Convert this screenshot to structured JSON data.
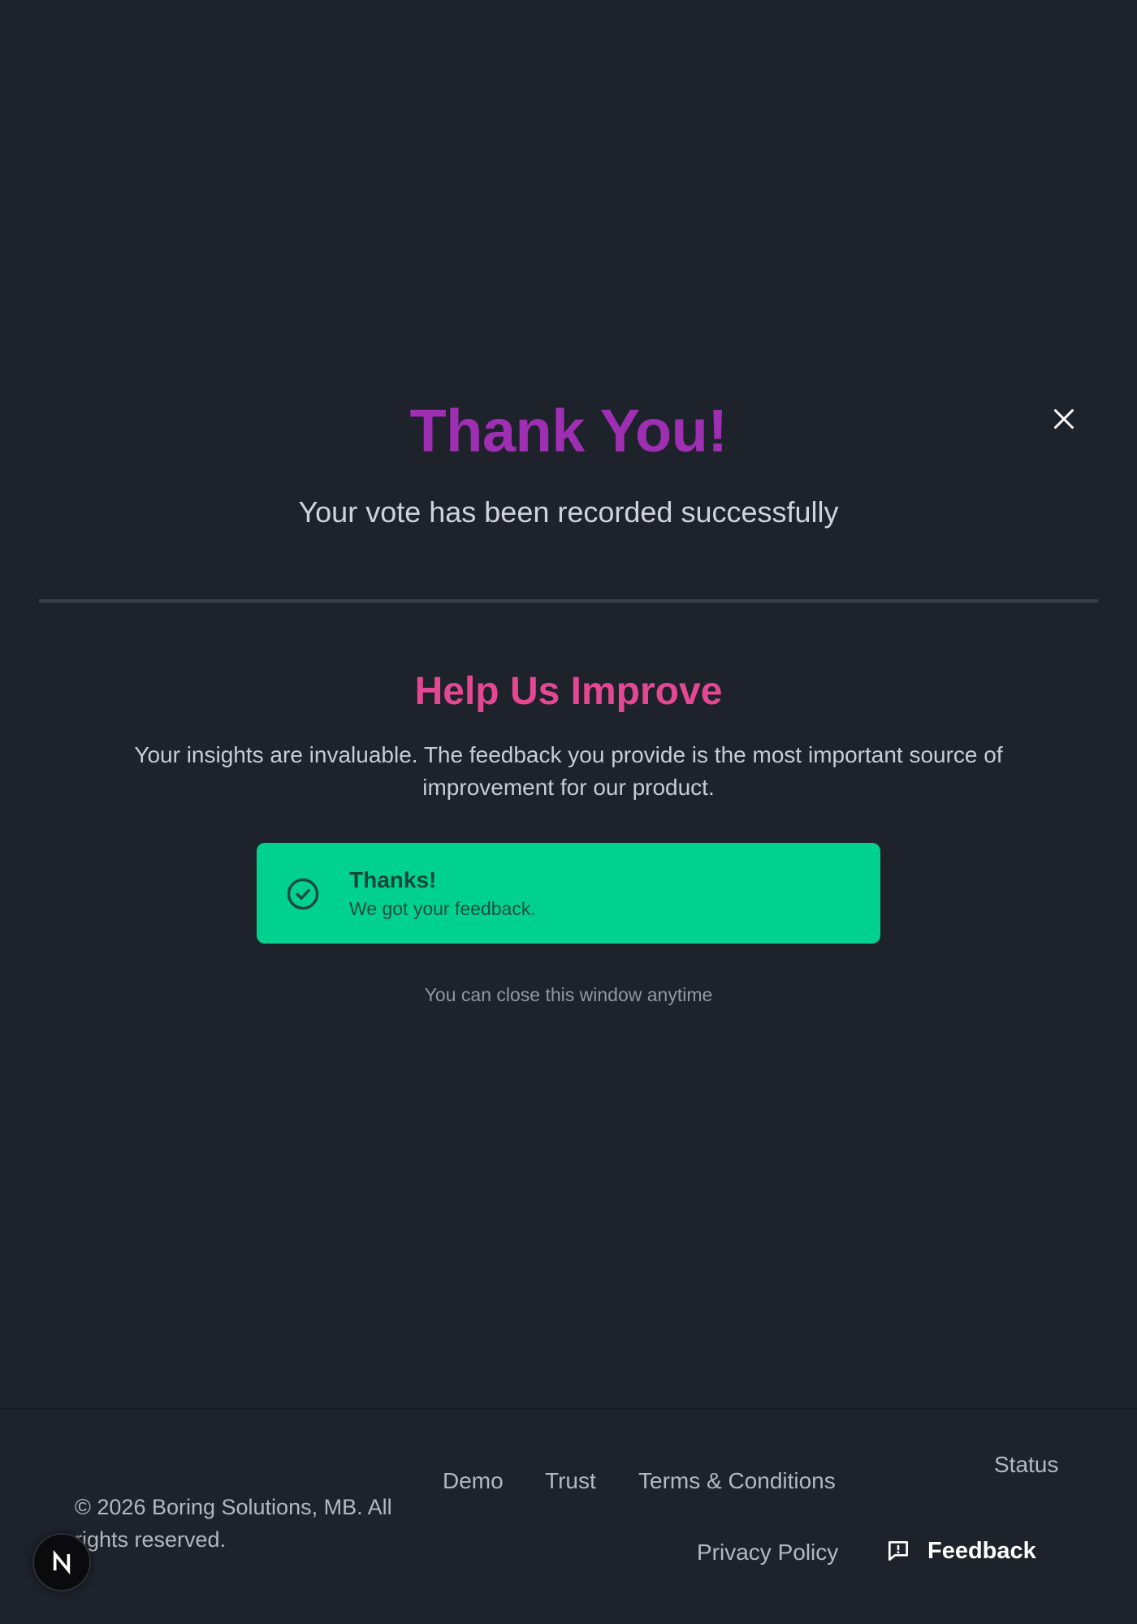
{
  "modal": {
    "close_icon": "close-icon",
    "title": "Thank You!",
    "subtitle": "Your vote has been recorded successfully"
  },
  "feedback_section": {
    "title": "Help Us Improve",
    "text": "Your insights are invaluable. The feedback you provide is the most important source of improvement for our product.",
    "toast": {
      "icon": "check-circle-icon",
      "title": "Thanks!",
      "text": "We got your feedback."
    },
    "hint": "You can close this window anytime"
  },
  "footer": {
    "copyright": "© 2026 Boring Solutions, MB. All rights reserved.",
    "links": {
      "demo": "Demo",
      "trust": "Trust",
      "terms": "Terms & Conditions",
      "status": "Status",
      "privacy": "Privacy Policy"
    },
    "feedback_button": {
      "icon": "message-alert-icon",
      "label": "Feedback"
    }
  },
  "dev_badge": {
    "icon": "nextjs-logo-icon"
  },
  "colors": {
    "background": "#1e222b",
    "title": "#9e2fb3",
    "section_title": "#e44893",
    "toast": "#00d18f"
  }
}
